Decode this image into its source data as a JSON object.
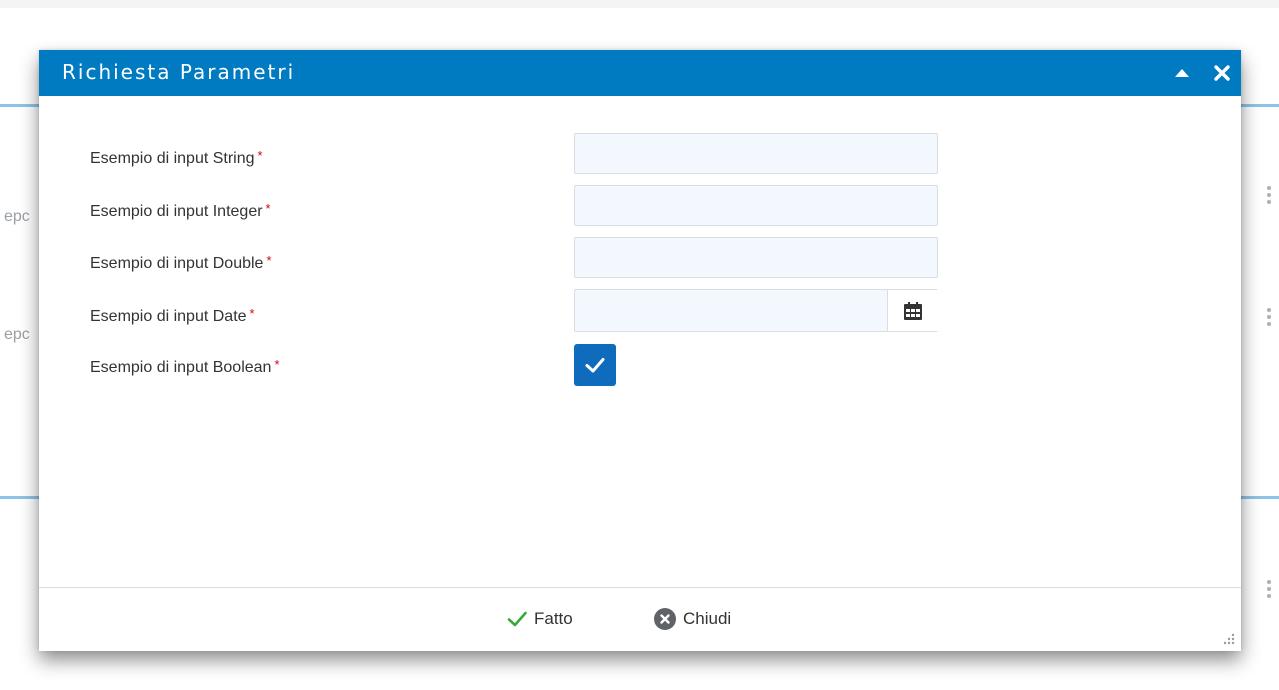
{
  "background": {
    "partial_text_1": "epc",
    "partial_text_2": "epc"
  },
  "dialog": {
    "title": "Richiesta Parametri",
    "header_color": "#007bc2",
    "collapse_icon": "caret-up-icon",
    "close_icon": "close-icon"
  },
  "form": {
    "fields": [
      {
        "label": "Esempio di input String",
        "required_mark": "*",
        "type": "string",
        "value": ""
      },
      {
        "label": "Esempio di input Integer",
        "required_mark": "*",
        "type": "integer",
        "value": ""
      },
      {
        "label": "Esempio di input Double",
        "required_mark": "*",
        "type": "double",
        "value": ""
      },
      {
        "label": "Esempio di input Date",
        "required_mark": "*",
        "type": "date",
        "value": "",
        "icon": "calendar-icon"
      },
      {
        "label": "Esempio di input Boolean",
        "required_mark": "*",
        "type": "boolean",
        "checked": true
      }
    ],
    "required_color": "#d0021b",
    "checkbox_color": "#0f6cbd"
  },
  "footer": {
    "done_label": "Fatto",
    "done_icon": "checkmark-icon",
    "done_icon_color": "#3aa83a",
    "cancel_label": "Chiudi",
    "cancel_icon": "close-circle-icon",
    "cancel_icon_color": "#5f6368"
  }
}
